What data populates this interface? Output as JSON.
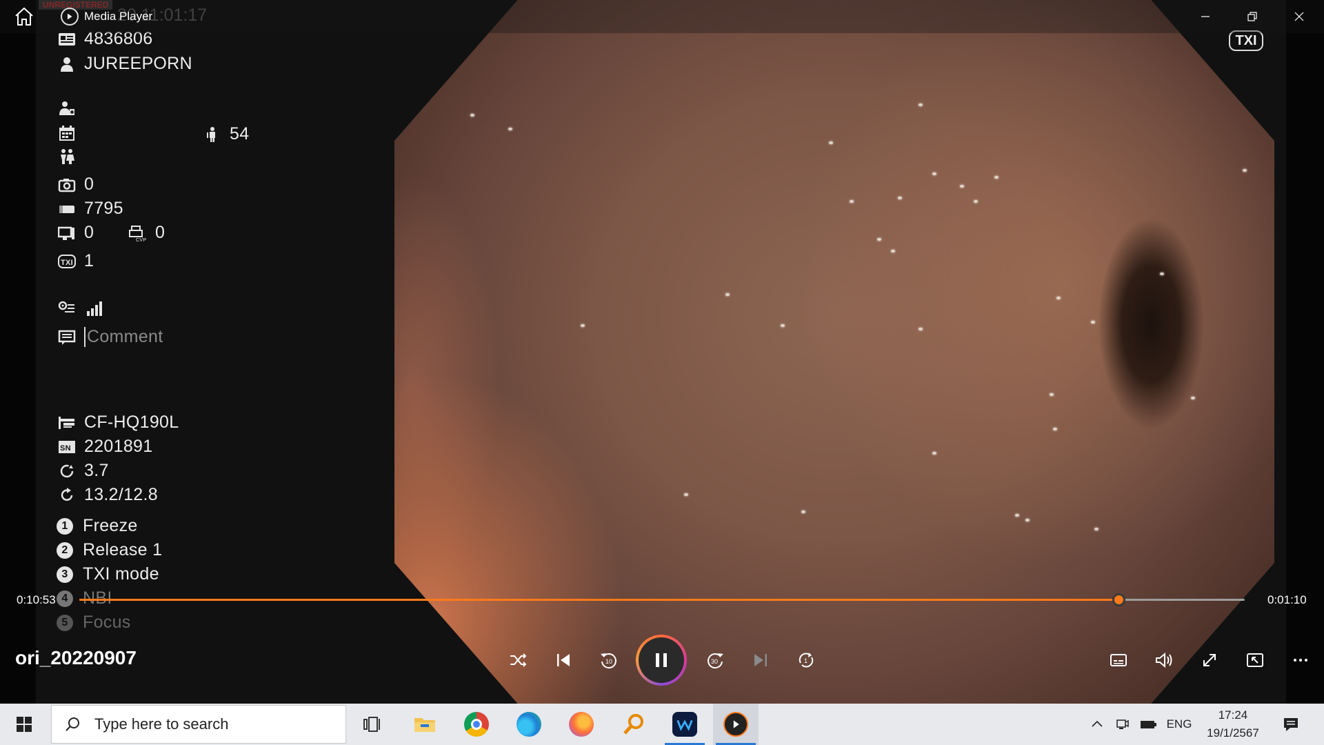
{
  "window": {
    "app_title": "Media Player",
    "watermark": "UNREGISTERED",
    "osd_datetime_partial": "20   11:01:17"
  },
  "osd": {
    "patient_id": "4836806",
    "patient_name": "JUREEPORN",
    "age": "54",
    "capture_count": "0",
    "counter": "7795",
    "monitor_count": "0",
    "cvp_count": "0",
    "txi_level": "1",
    "comment_placeholder": "Comment",
    "scope_model": "CF-HQ190L",
    "scope_sn": "2201891",
    "value_a": "3.7",
    "value_b": "13.2/12.8",
    "function_keys": [
      {
        "num": "1",
        "label": "Freeze"
      },
      {
        "num": "2",
        "label": "Release 1"
      },
      {
        "num": "3",
        "label": "TXI mode"
      },
      {
        "num": "4",
        "label": "NBI"
      },
      {
        "num": "5",
        "label": "Focus"
      }
    ],
    "txi_badge": "TXI"
  },
  "player": {
    "elapsed": "0:10:53",
    "remaining": "0:01:10",
    "progress": 0.892,
    "title": "ori_20220907"
  },
  "taskbar": {
    "search_placeholder": "Type here to search",
    "language": "ENG",
    "time": "17:24",
    "date": "19/1/2567"
  },
  "colors": {
    "accent": "#ff7a1a",
    "taskbar_bg": "#e7e9ed",
    "active_indicator": "#2a78d6"
  }
}
